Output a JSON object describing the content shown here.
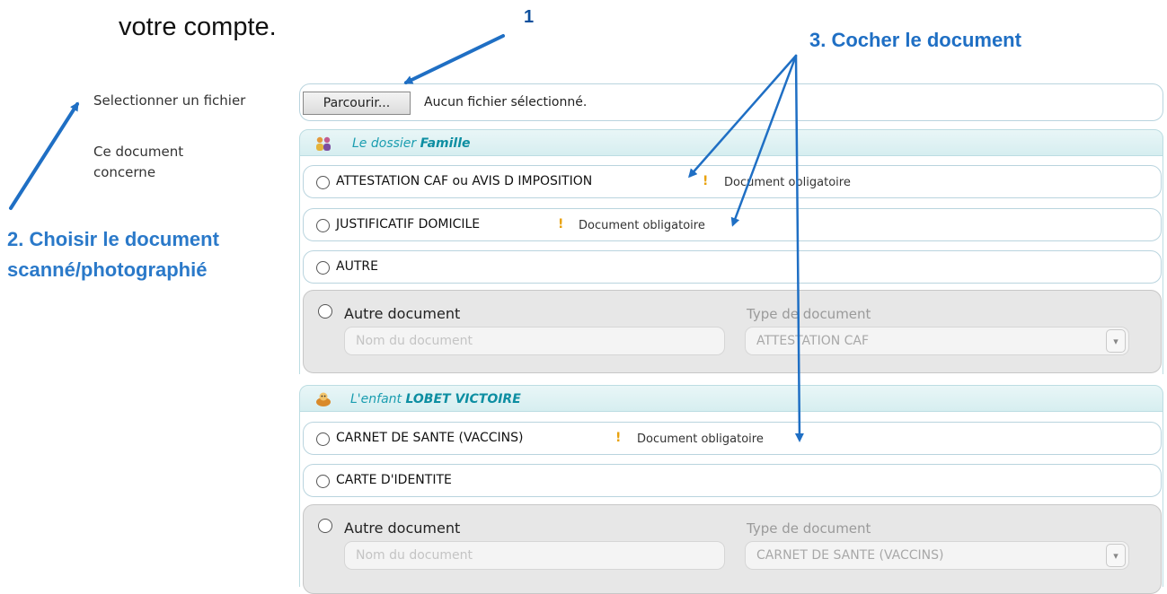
{
  "intro_text": "votre compte.",
  "callouts": {
    "one": "1",
    "choose_line1": "2. Choisir le document",
    "choose_line2": "scanné/photographié",
    "check": "3. Cocher le document"
  },
  "form": {
    "file_label": "Selectionner un fichier",
    "concern_label_line1": "Ce document",
    "concern_label_line2": "concerne",
    "browse_button": "Parcourir...",
    "file_status": "Aucun fichier sélectionné."
  },
  "sections": {
    "famille": {
      "title_prefix": "Le dossier ",
      "title_strong": "Famille",
      "options": [
        {
          "label": "ATTESTATION CAF ou AVIS D IMPOSITION",
          "required": "Document obligatoire"
        },
        {
          "label": "JUSTIFICATIF DOMICILE",
          "required": "Document obligatoire"
        },
        {
          "label": "AUTRE"
        }
      ],
      "other": {
        "label": "Autre document",
        "type_label": "Type de document",
        "name_placeholder": "Nom du document",
        "type_value": "ATTESTATION CAF"
      }
    },
    "enfant": {
      "title_prefix": "L'enfant ",
      "title_strong": "LOBET VICTOIRE",
      "options": [
        {
          "label": "CARNET DE SANTE (VACCINS)",
          "required": "Document obligatoire"
        },
        {
          "label": "CARTE D'IDENTITE"
        }
      ],
      "other": {
        "label": "Autre document",
        "type_label": "Type de document",
        "name_placeholder": "Nom du document",
        "type_value": "CARNET DE SANTE (VACCINS)"
      }
    }
  },
  "icons": {
    "warning": "!",
    "select_arrow": "▾"
  },
  "colors": {
    "callout_blue": "#1f6fc4",
    "section_title": "#1a9db0",
    "warning": "#e8a20e"
  }
}
